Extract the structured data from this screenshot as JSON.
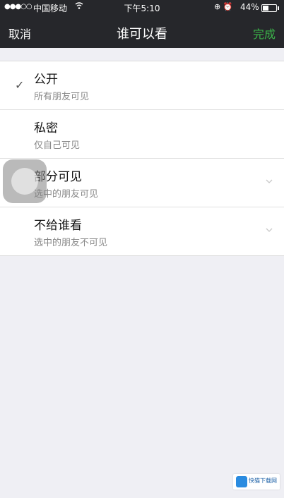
{
  "status_bar": {
    "signal": "●●●○○",
    "carrier": "中国移动",
    "wifi_icon": "wifi-icon",
    "time": "下午5:10",
    "battery": "44%"
  },
  "nav": {
    "cancel": "取消",
    "title": "谁可以看",
    "done": "完成"
  },
  "options": [
    {
      "title": "公开",
      "subtitle": "所有朋友可见",
      "selected": true,
      "expandable": false
    },
    {
      "title": "私密",
      "subtitle": "仅自己可见",
      "selected": false,
      "expandable": false
    },
    {
      "title": "部分可见",
      "subtitle": "选中的朋友可见",
      "selected": false,
      "expandable": true
    },
    {
      "title": "不给谁看",
      "subtitle": "选中的朋友不可见",
      "selected": false,
      "expandable": true
    }
  ],
  "watermark": {
    "text": "快猫下载网"
  },
  "colors": {
    "nav_bg": "#26272b",
    "done_green": "#3bb54a",
    "page_bg": "#efeff4"
  }
}
